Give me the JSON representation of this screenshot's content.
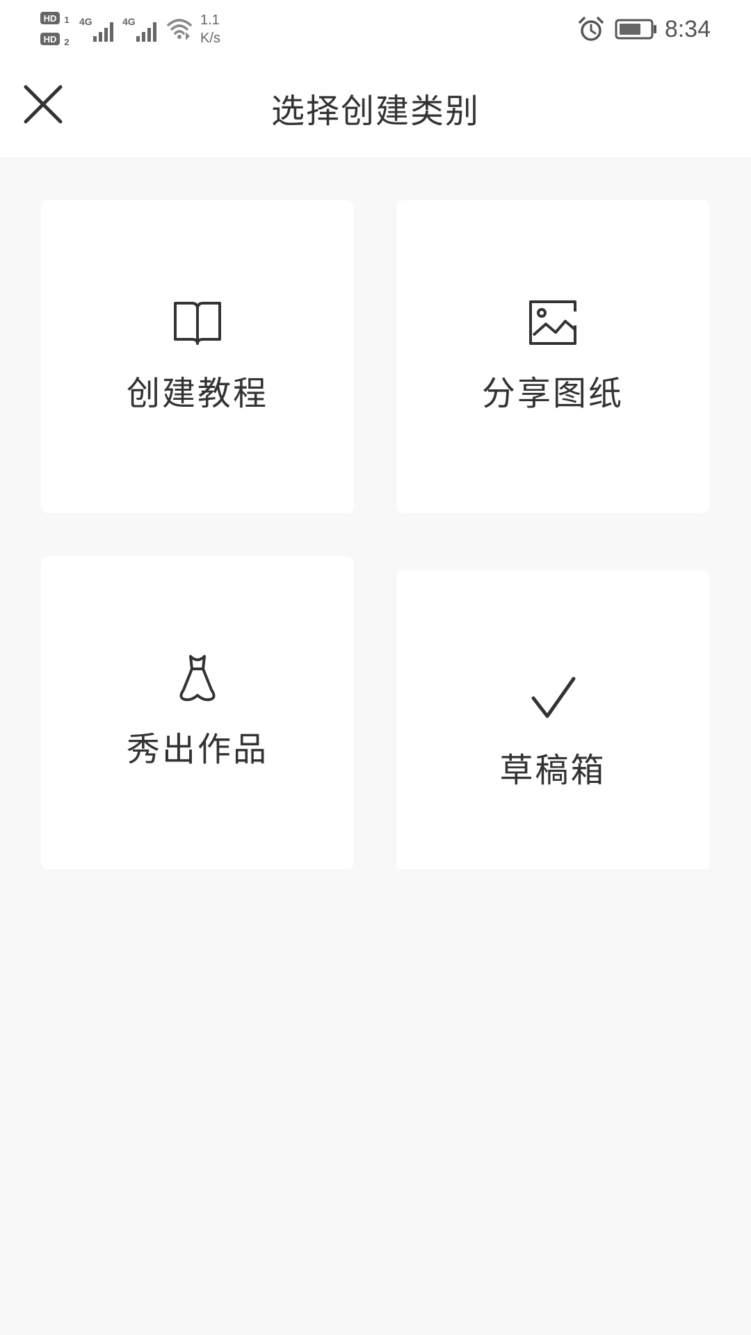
{
  "status_bar": {
    "sim1_label": "HD",
    "sim1_index": "1",
    "sim2_label": "HD",
    "sim2_index": "2",
    "network_type_1": "4G",
    "network_type_2": "4G",
    "net_speed_value": "1.1",
    "net_speed_unit": "K/s",
    "time": "8:34",
    "icons": [
      "hd-sim-icon",
      "signal-icon",
      "wifi-icon",
      "alarm-icon",
      "battery-icon"
    ]
  },
  "header": {
    "close_icon": "close-icon",
    "title": "选择创建类别"
  },
  "cards": [
    {
      "label": "创建教程",
      "icon": "book-icon"
    },
    {
      "label": "分享图纸",
      "icon": "image-icon"
    },
    {
      "label": "秀出作品",
      "icon": "dress-icon"
    },
    {
      "label": "草稿箱",
      "icon": "check-icon"
    }
  ],
  "colors": {
    "background": "#f8f8f8",
    "card": "#ffffff",
    "text": "#333333"
  }
}
